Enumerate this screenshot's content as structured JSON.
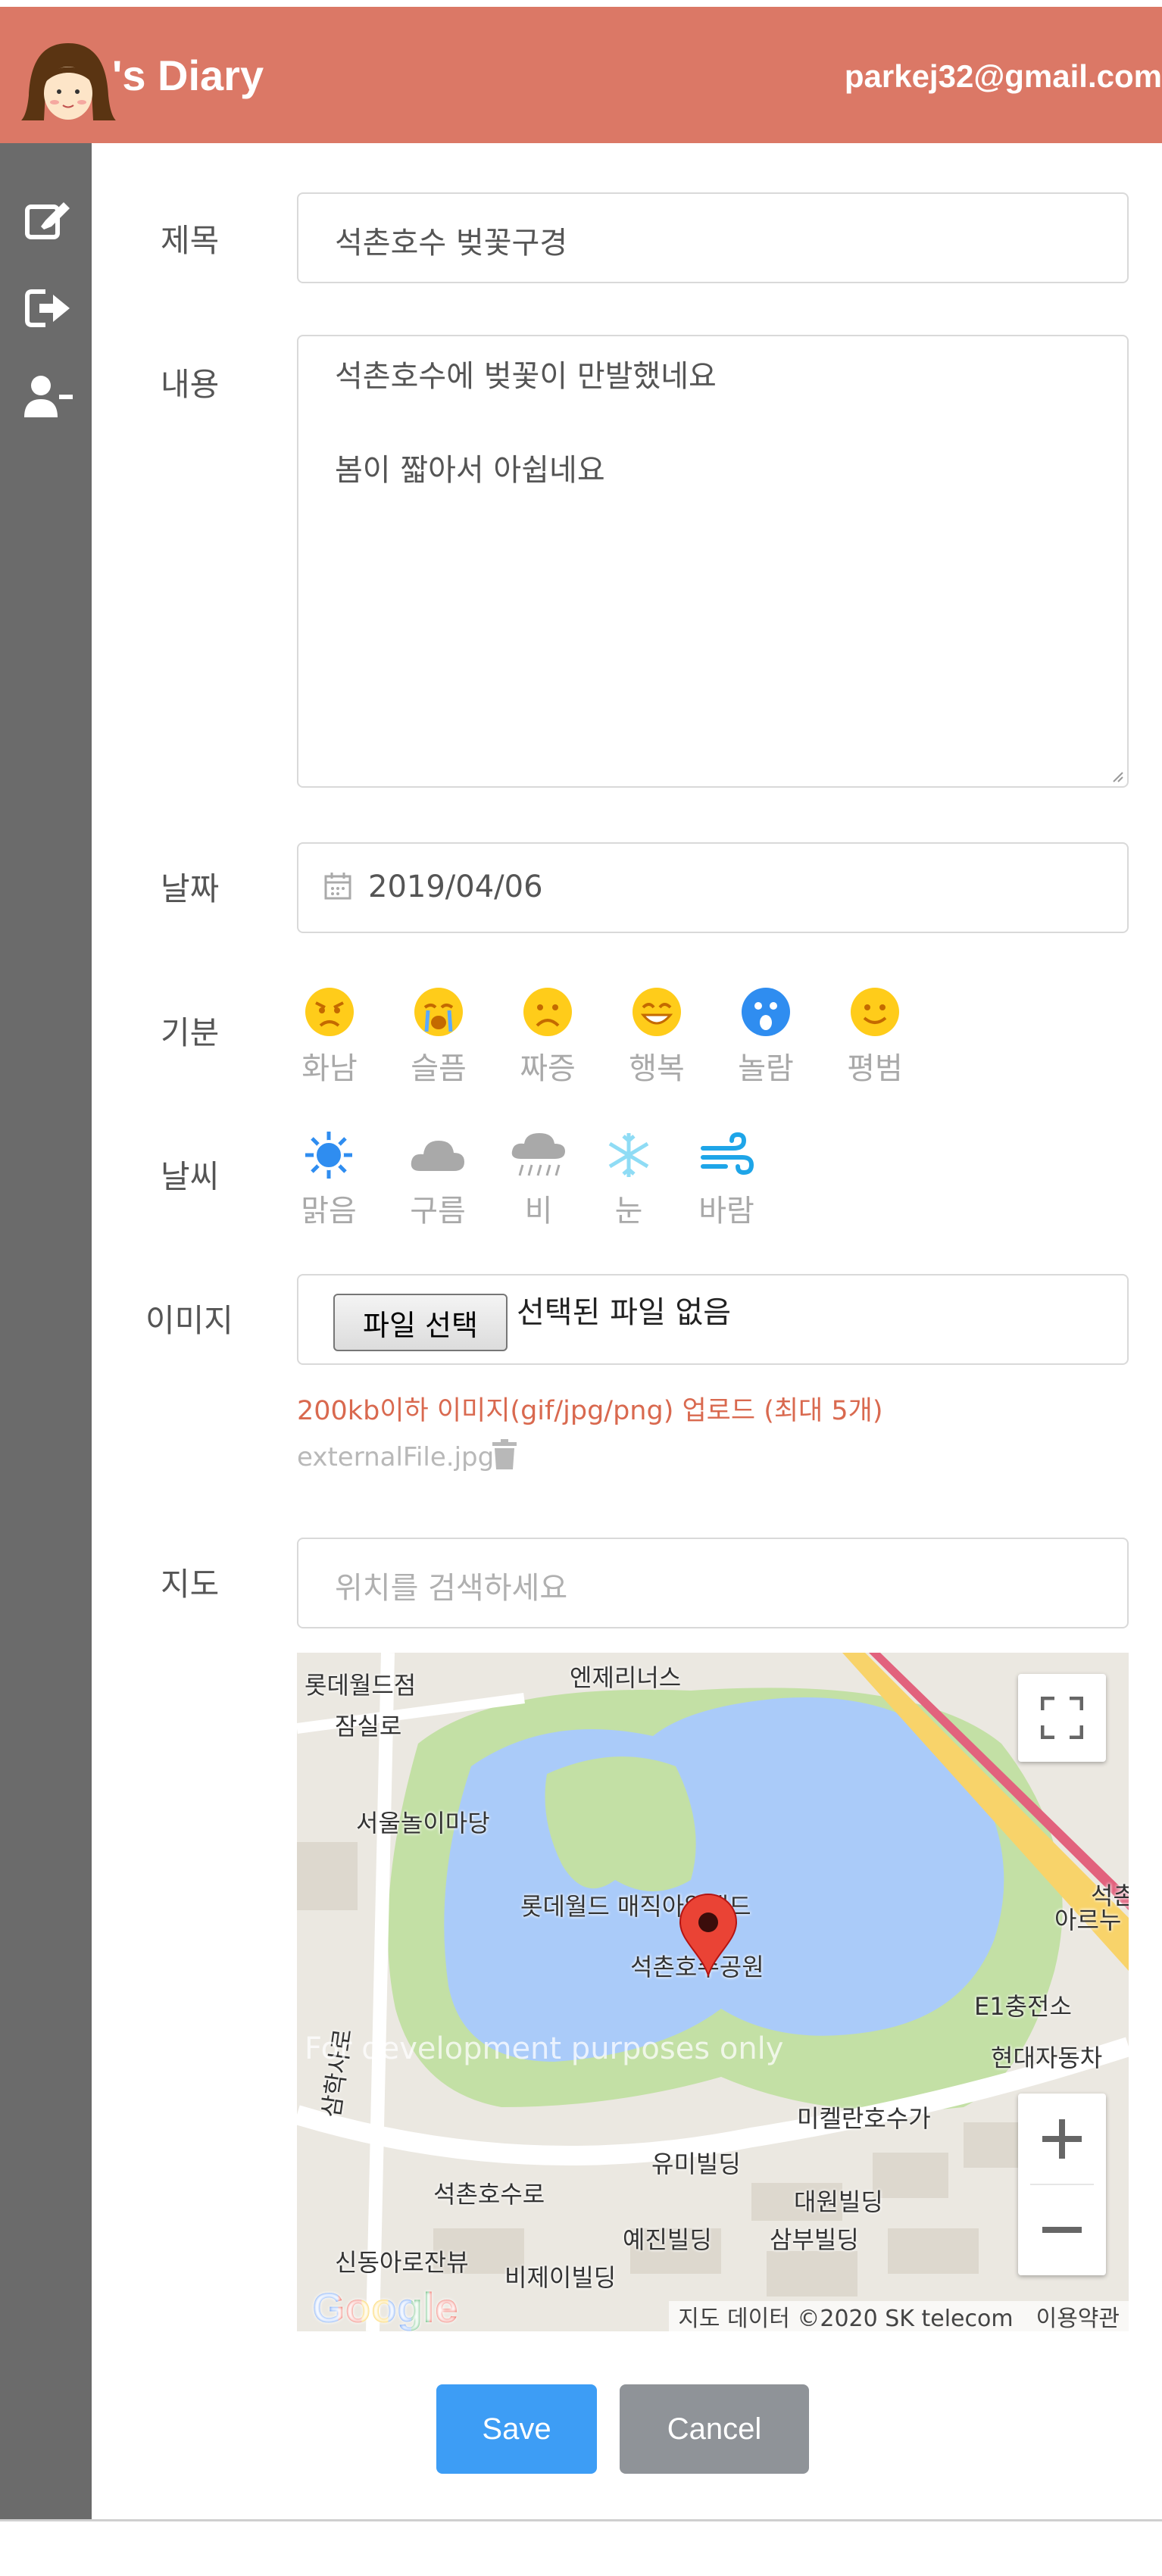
{
  "header": {
    "brand": "'s Diary",
    "email": "parkej32@gmail.com",
    "color": "#db7866"
  },
  "sidebar": {
    "items": [
      {
        "icon": "edit-icon"
      },
      {
        "icon": "logout-icon"
      },
      {
        "icon": "remove-user-icon"
      }
    ]
  },
  "form": {
    "title_label": "제목",
    "title_value": "석촌호수 벚꽃구경",
    "content_label": "내용",
    "content_line1": "석촌호수에 벚꽃이 만발했네요",
    "content_line2": "봄이 짧아서 아쉽네요",
    "date_label": "날짜",
    "date_value": "2019/04/06",
    "mood_label": "기분",
    "moods": [
      {
        "label": "화남",
        "icon": "angry-face-icon"
      },
      {
        "label": "슬픔",
        "icon": "crying-face-icon"
      },
      {
        "label": "짜증",
        "icon": "frowning-face-icon"
      },
      {
        "label": "행복",
        "icon": "happy-face-icon"
      },
      {
        "label": "놀람",
        "icon": "surprised-face-icon"
      },
      {
        "label": "평범",
        "icon": "neutral-face-icon"
      }
    ],
    "mood_selected": "놀람",
    "weather_label": "날씨",
    "weathers": [
      {
        "label": "맑음",
        "icon": "sun-icon"
      },
      {
        "label": "구름",
        "icon": "cloud-icon"
      },
      {
        "label": "비",
        "icon": "rain-icon"
      },
      {
        "label": "눈",
        "icon": "snowflake-icon"
      },
      {
        "label": "바람",
        "icon": "wind-icon"
      }
    ],
    "weather_selected": [
      "맑음",
      "눈",
      "바람"
    ],
    "image_label": "이미지",
    "file_button": "파일 선택",
    "file_status": "선택된 파일 없음",
    "image_hint": "200kb이하 이미지(gif/jpg/png) 업로드 (최대 5개)",
    "existing_file": "externalFile.jpg",
    "map_label": "지도",
    "map_search_placeholder": "위치를 검색하세요"
  },
  "map": {
    "labels": [
      "롯데월드점",
      "엔제리너스",
      "잠실로",
      "서울놀이마당",
      "롯데월드 매직아일랜드",
      "석촌호수공원",
      "E1충전소",
      "현대자동차",
      "미켈란호수가",
      "유미빌딩",
      "석촌호수로",
      "대원빌딩",
      "삼부빌딩",
      "예진빌딩",
      "신동아로잔뷰",
      "비제이빌딩",
      "삼학사로",
      "석촌",
      "아르누"
    ],
    "watermark": "For development purposes only",
    "attribution": "지도 데이터 ©2020 SK telecom",
    "terms": "이용약관",
    "google": "Google"
  },
  "actions": {
    "save": "Save",
    "cancel": "Cancel"
  }
}
